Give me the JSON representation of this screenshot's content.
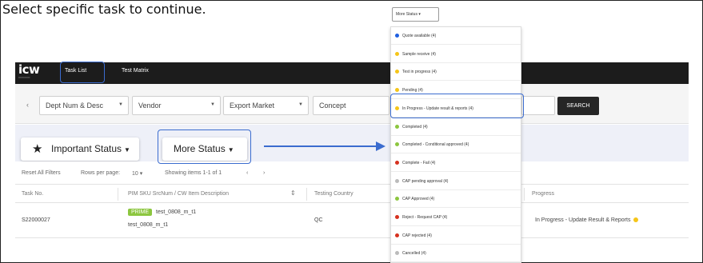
{
  "instruction": "Select specific task to continue.",
  "app": {
    "logo": "icw",
    "nav": {
      "task_list": "Task List",
      "test_matrix": "Test Matrix"
    },
    "filters": {
      "dept": "Dept Num & Desc",
      "vendor": "Vendor",
      "export_market": "Export Market",
      "concept": "Concept",
      "search_button": "SEARCH"
    },
    "status_buttons": {
      "important": "Important Status",
      "more": "More Status"
    },
    "pager": {
      "reset": "Reset All Filters",
      "rows_label": "Rows per page:",
      "rows_value": "10",
      "showing": "Showing items 1-1 of 1"
    },
    "table": {
      "headers": {
        "task_no": "Task No.",
        "item_desc": "PIM SKU SrcNum / CW Item Description",
        "country": "Testing Country",
        "progress": "Progress"
      },
      "rows": [
        {
          "task_no": "S22000027",
          "badge": "PRIME",
          "sku": "test_0808_m_t1",
          "desc": "test_0808_m_t1",
          "country": "QC",
          "progress": "In Progress - Update Result & Reports"
        }
      ]
    }
  },
  "dropdown": {
    "trigger": "More Status",
    "items": [
      {
        "label": "Quote available (4)",
        "color": "#1f5fe0"
      },
      {
        "label": "Sample receive (4)",
        "color": "#f5c518"
      },
      {
        "label": "Test in progress (4)",
        "color": "#f5c518"
      },
      {
        "label": "Pending (4)",
        "color": "#f5c518"
      },
      {
        "label": "In Progress - Update result & reports (4)",
        "color": "#f5c518"
      },
      {
        "label": "Completed (4)",
        "color": "#8cc63f"
      },
      {
        "label": "Completed - Conditional approved (4)",
        "color": "#8cc63f"
      },
      {
        "label": "Complete - Fail (4)",
        "color": "#d6311f"
      },
      {
        "label": "CAP pending approval (4)",
        "color": "#bbbbbb"
      },
      {
        "label": "CAP Approved (4)",
        "color": "#8cc63f"
      },
      {
        "label": "Reject - Request CAP (4)",
        "color": "#d6311f"
      },
      {
        "label": "CAP rejected  (4)",
        "color": "#d6311f"
      },
      {
        "label": "Cancelled (4)",
        "color": "#bbbbbb"
      }
    ]
  },
  "colors": {
    "highlight": "#3b6ccf",
    "topbar": "#1c1c1c",
    "status_bg": "#eef0f8"
  }
}
